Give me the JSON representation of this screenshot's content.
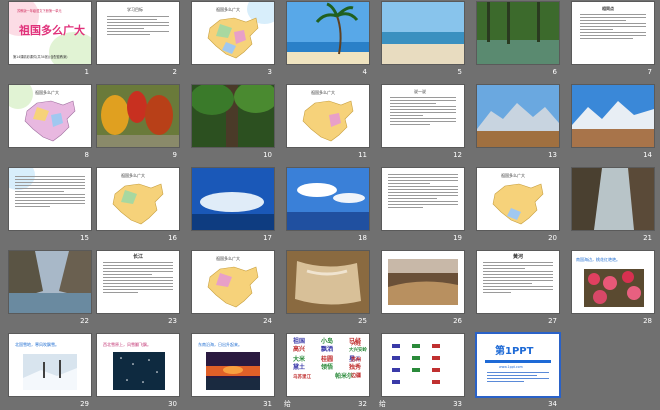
{
  "slides": [
    {
      "n": "1",
      "title": "祖国多么广大",
      "kicker": "苏教版一年级语文下册第一单元",
      "footer": "第14课精彩课件(共34张)(含配套教案)"
    },
    {
      "n": "2",
      "title": "学习目标"
    },
    {
      "n": "3",
      "title": "祖国多么广大"
    },
    {
      "n": "4"
    },
    {
      "n": "5"
    },
    {
      "n": "6"
    },
    {
      "n": "7",
      "title": "相同点"
    },
    {
      "n": "8",
      "title": "祖国多么广大"
    },
    {
      "n": "9"
    },
    {
      "n": "10"
    },
    {
      "n": "11",
      "title": "祖国多么广大"
    },
    {
      "n": "12",
      "title": "说一说"
    },
    {
      "n": "13"
    },
    {
      "n": "14"
    },
    {
      "n": "15"
    },
    {
      "n": "16",
      "title": "祖国多么广大"
    },
    {
      "n": "17"
    },
    {
      "n": "18"
    },
    {
      "n": "19"
    },
    {
      "n": "20",
      "title": "祖国多么广大"
    },
    {
      "n": "21"
    },
    {
      "n": "22"
    },
    {
      "n": "23",
      "title": "长江"
    },
    {
      "n": "24",
      "title": "祖国多么广大"
    },
    {
      "n": "25"
    },
    {
      "n": "26"
    },
    {
      "n": "27",
      "title": "黄河"
    },
    {
      "n": "28",
      "title": "南国海边，桃花红艳艳。"
    },
    {
      "n": "29",
      "title": "北国雪地，寒风吹飘雪。"
    },
    {
      "n": "30",
      "title": "西北雪原上，风雪翻飞飘。"
    },
    {
      "n": "31",
      "title": "东南沿海，日出升起来。"
    },
    {
      "n": "32",
      "words": [
        "祖国",
        "小岛",
        "已经",
        "兴旺",
        "高兴",
        "飘洒",
        "大兴安岭",
        "大米",
        "桂圆",
        "星斗",
        "苏州",
        "黛土",
        "领悟",
        "独秀",
        "边疆",
        "乌苏里江",
        "帕米尔"
      ],
      "note": "给"
    },
    {
      "n": "33",
      "note": "给"
    },
    {
      "n": "34",
      "logo": "第1PPT",
      "sub": "www.1ppt.com"
    }
  ]
}
